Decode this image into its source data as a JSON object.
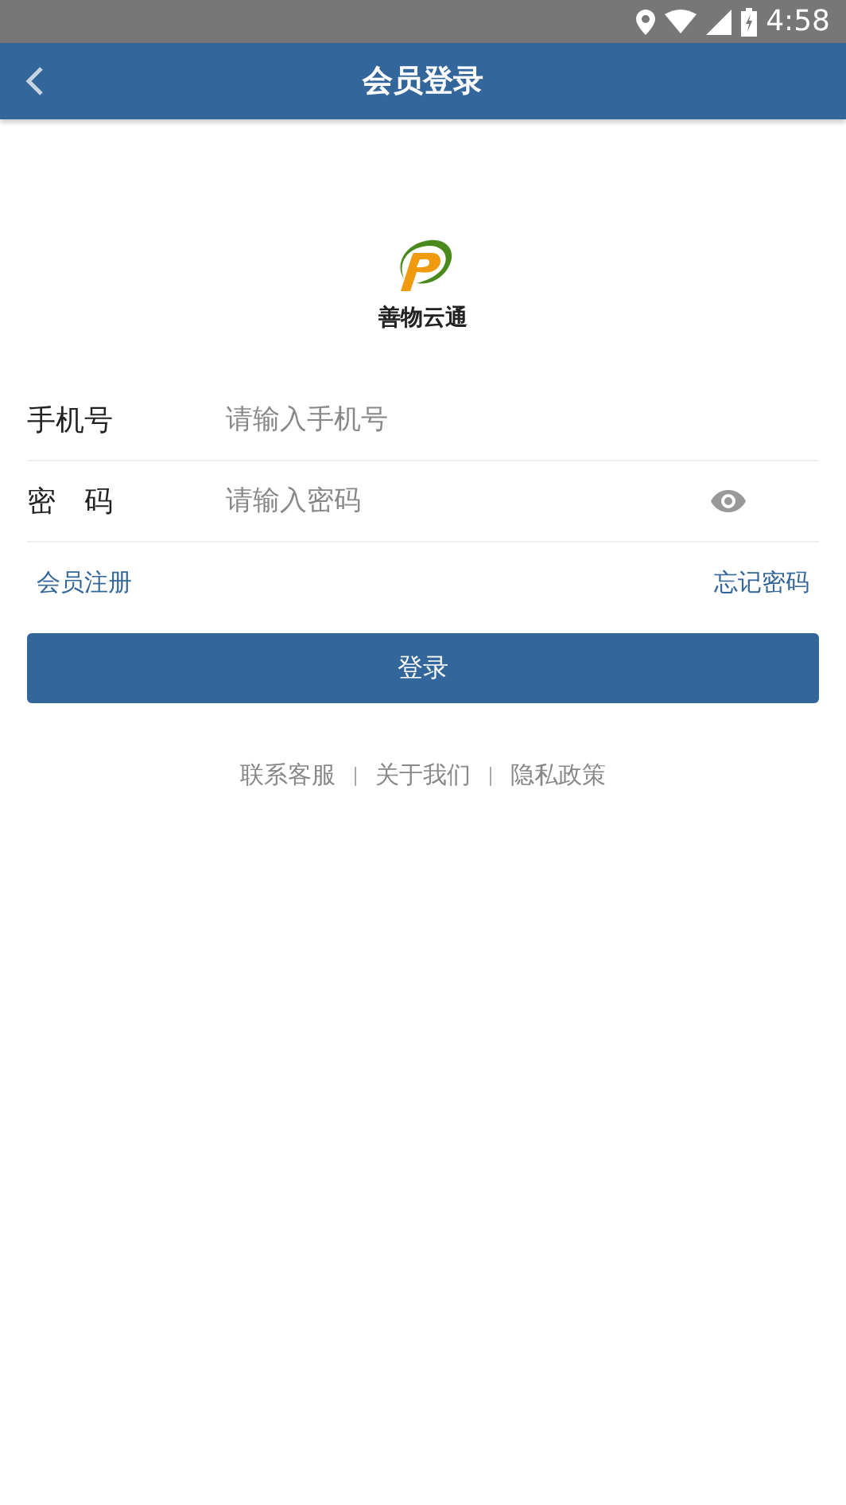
{
  "status_bar": {
    "time": "4:58"
  },
  "header": {
    "title": "会员登录"
  },
  "logo": {
    "name": "善物云通"
  },
  "fields": [
    {
      "label": "手机号",
      "placeholder": "请输入手机号",
      "kind": "text"
    },
    {
      "label": "密　码",
      "placeholder": "请输入密码",
      "kind": "password"
    }
  ],
  "links": {
    "register": "会员注册",
    "forgot": "忘记密码"
  },
  "login_button": "登录",
  "footer_links": [
    "联系客服",
    "关于我们",
    "隐私政策"
  ]
}
